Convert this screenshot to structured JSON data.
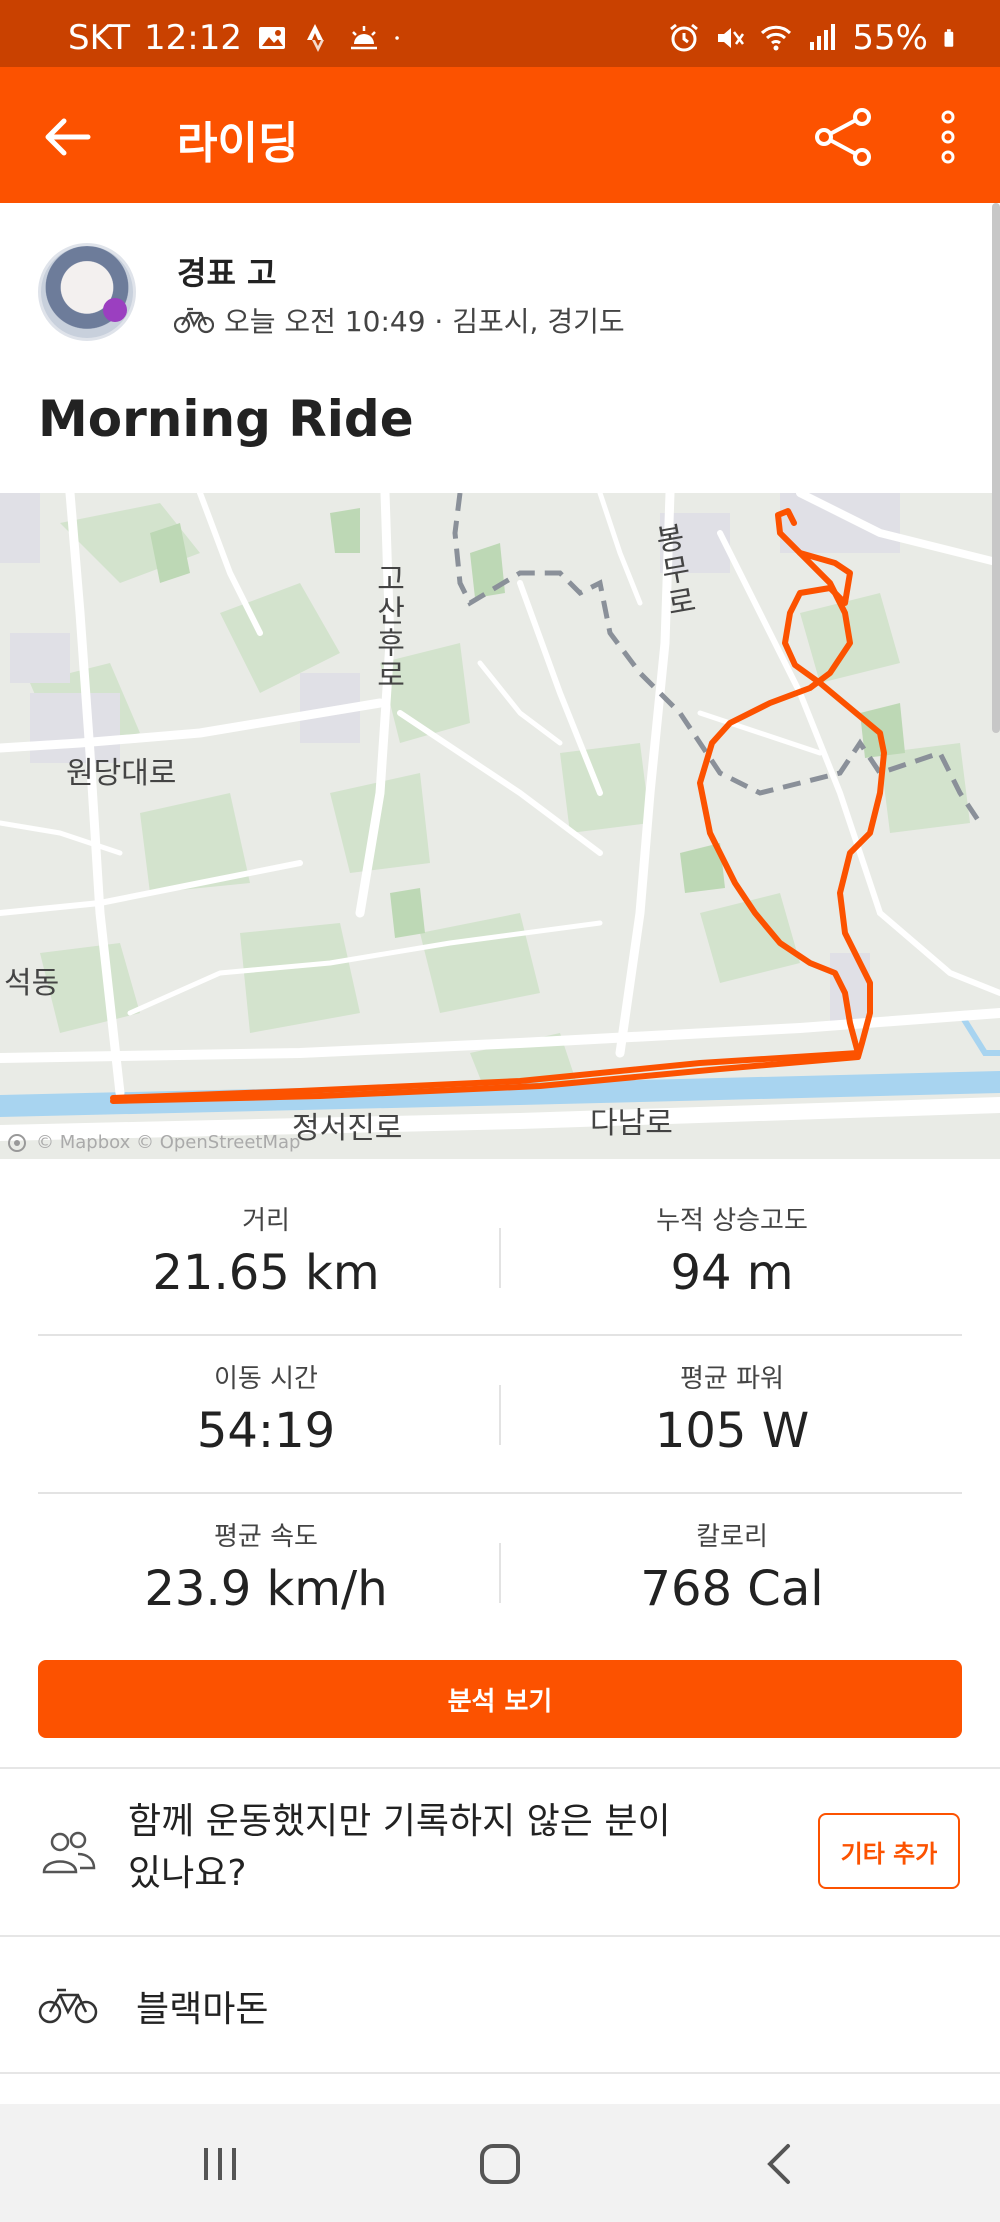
{
  "status_bar": {
    "carrier": "SKT",
    "time": "12:12",
    "battery": "55%",
    "background_color": "#c94100",
    "icons": [
      "image-icon",
      "strava-icon",
      "weather-icon",
      "dot-icon",
      "alarm-icon",
      "mute-icon",
      "wifi-icon",
      "signal-icon",
      "battery-icon"
    ]
  },
  "app_bar": {
    "title": "라이딩",
    "color": "#fc5200",
    "icons": [
      "back-arrow-icon",
      "share-icon",
      "more-vertical-icon"
    ]
  },
  "activity": {
    "athlete_name": "경표 고",
    "sport_icon": "bicycle-icon",
    "meta": "오늘 오전 10:49 · 김포시, 경기도",
    "title": "Morning Ride"
  },
  "map": {
    "labels": {
      "wondang": "원당대로",
      "gosanhu": "고산후로",
      "bongmu": "봉무로",
      "seokdong": "석동",
      "jeongseo": "정서진로",
      "danam": "다남로"
    },
    "attribution": "© Mapbox © OpenStreetMap",
    "route_color": "#fc5200",
    "water_color": "#a8d4f0"
  },
  "stats": [
    {
      "label": "거리",
      "value": "21.65 km"
    },
    {
      "label": "누적 상승고도",
      "value": "94 m"
    },
    {
      "label": "이동 시간",
      "value": "54:19"
    },
    {
      "label": "평균 파워",
      "value": "105 W"
    },
    {
      "label": "평균 속도",
      "value": "23.9 km/h"
    },
    {
      "label": "칼로리",
      "value": "768 Cal"
    }
  ],
  "analysis_button": "분석 보기",
  "group_prompt": {
    "line1": "함께 운동했지만 기록하지 않은 분이",
    "line2": "있나요?",
    "button": "기타 추가",
    "icon": "people-icon"
  },
  "gear": {
    "icon": "bicycle-icon",
    "name": "블랙마돈"
  },
  "nav_bar": {
    "icons": [
      "recent-apps-icon",
      "home-icon",
      "back-icon"
    ]
  }
}
